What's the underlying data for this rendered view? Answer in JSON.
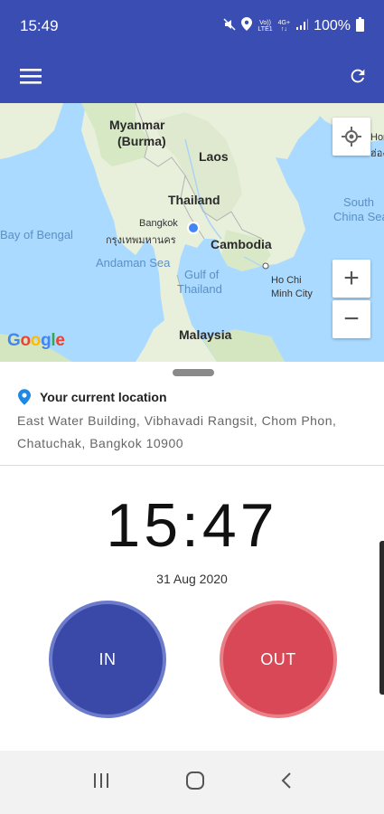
{
  "status_bar": {
    "time": "15:49",
    "network_top": "Vo))",
    "network_bottom": "LTE1",
    "signal_label": "4G+",
    "battery": "100%"
  },
  "app_bar": {
    "menu_icon": "hamburger-menu-icon",
    "refresh_icon": "refresh-icon",
    "background": "#3a4db3"
  },
  "map": {
    "labels": {
      "myanmar": "Myanmar",
      "burma": "(Burma)",
      "laos": "Laos",
      "thailand": "Thailand",
      "cambodia": "Cambodia",
      "malaysia": "Malaysia",
      "bangkok": "Bangkok",
      "bangkok_thai": "กรุงเทพมหานคร",
      "bay_of_bengal": "Bay of Bengal",
      "andaman_sea": "Andaman Sea",
      "gulf_of_thailand_1": "Gulf of",
      "gulf_of_thailand_2": "Thailand",
      "south_china_sea_1": "South",
      "south_china_sea_2": "China Sea",
      "ho_chi_minh_1": "Ho Chi",
      "ho_chi_minh_2": "Minh City",
      "hong_kong_partial": "Hong",
      "hong_kong_thai_partial": "ฮ่องกง"
    },
    "zoom_in_label": "+",
    "zoom_out_label": "−",
    "logo": "Google"
  },
  "location": {
    "title": "Your current location",
    "address": "East Water Building, Vibhavadi Rangsit, Chom Phon, Chatuchak, Bangkok 10900"
  },
  "clock": {
    "time": "15:47",
    "date": "31 Aug 2020"
  },
  "buttons": {
    "in_label": "IN",
    "out_label": "OUT",
    "in_color": "#3a49a8",
    "out_color": "#d94856"
  },
  "nav": {
    "recents_icon": "recent-apps-icon",
    "home_icon": "home-icon",
    "back_icon": "back-icon"
  }
}
